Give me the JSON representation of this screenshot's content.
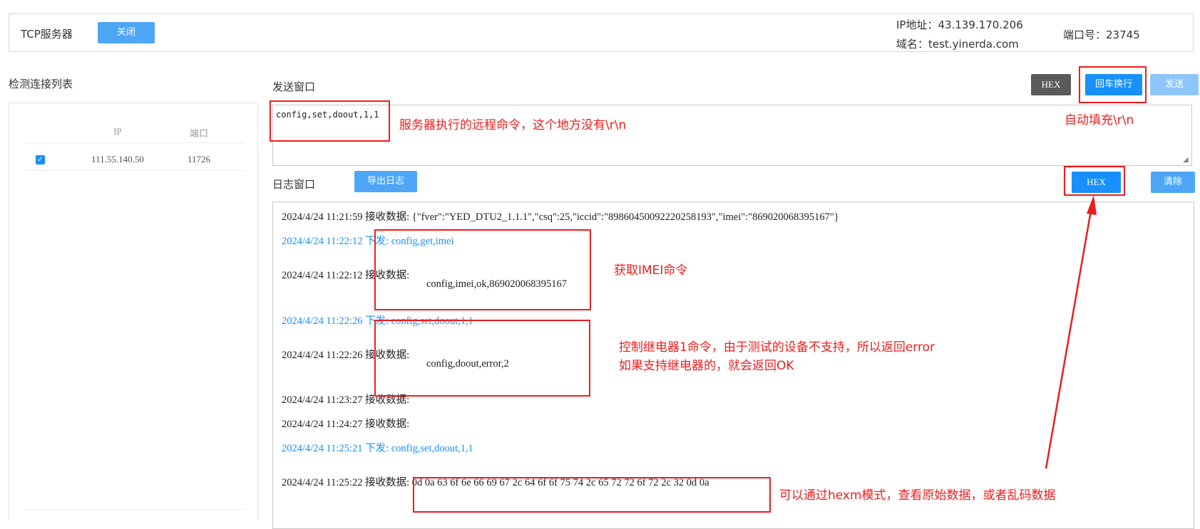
{
  "header": {
    "title": "TCP服务器",
    "close_label": "关闭",
    "ip_text": "IP地址：43.139.170.206",
    "domain_text": "域名：test.yinerda.com",
    "port_text": "端口号：23745"
  },
  "connections": {
    "title": "检测连接列表",
    "col_ip": "IP",
    "col_port": "端口",
    "rows": [
      {
        "checked": true,
        "ip": "111.55.140.50",
        "port": "11726"
      }
    ]
  },
  "send": {
    "title": "发送窗口",
    "hex_label": "HEX",
    "crlf_label": "回车换行",
    "send_label": "发送",
    "textarea_value": "config,set,doout,1,1"
  },
  "log": {
    "title": "日志窗口",
    "export_label": "导出日志",
    "hex_label": "HEX",
    "clear_label": "清除",
    "entries": [
      {
        "text": "2024/4/24 11:21:59 接收数据: {\"fver\":\"YED_DTU2_1.1.1\",\"csq\":25,\"iccid\":\"89860450092220258193\",\"imei\":\"869020068395167\"}"
      },
      {
        "text": "2024/4/24 11:22:12  下发:   config,get,imei"
      },
      {
        "text": "2024/4/24 11:22:12 接收数据:"
      },
      {
        "text": "config,imei,ok,869020068395167"
      },
      {
        "text": "2024/4/24 11:22:26  下发:   config,set,doout,1,1"
      },
      {
        "text": "2024/4/24 11:22:26 接收数据:"
      },
      {
        "text": "config,doout,error,2"
      },
      {
        "text": "2024/4/24 11:23:27 接收数据:"
      },
      {
        "text": "2024/4/24 11:24:27 接收数据:"
      },
      {
        "text": "2024/4/24 11:25:21   下发:   config,set,doout,1,1"
      },
      {
        "text": "2024/4/24 11:25:22 接收数据: 0d 0a 63 6f 6e 66 69 67 2c 64 6f 6f 75 74 2c 65 72 72 6f 72 2c 32 0d 0a"
      }
    ]
  },
  "annotations": {
    "remote_cmd": "服务器执行的远程命令，这个地方没有\\r\\n",
    "auto_fill": "自动填充\\r\\n",
    "get_imei": "获取IMEI命令",
    "relay_line1": "控制继电器1命令，由于测试的设备不支持，所以返回error",
    "relay_line2": "如果支持继电器的，就会返回OK",
    "hex_mode": "可以通过hexm模式，查看原始数据，或者乱码数据",
    "color": "#f01c1c"
  },
  "colors": {
    "primary": "#1890ff",
    "primary_light": "#4ea6f7",
    "disabled": "#8fc6fa",
    "dark_button": "#5a5a5a"
  }
}
